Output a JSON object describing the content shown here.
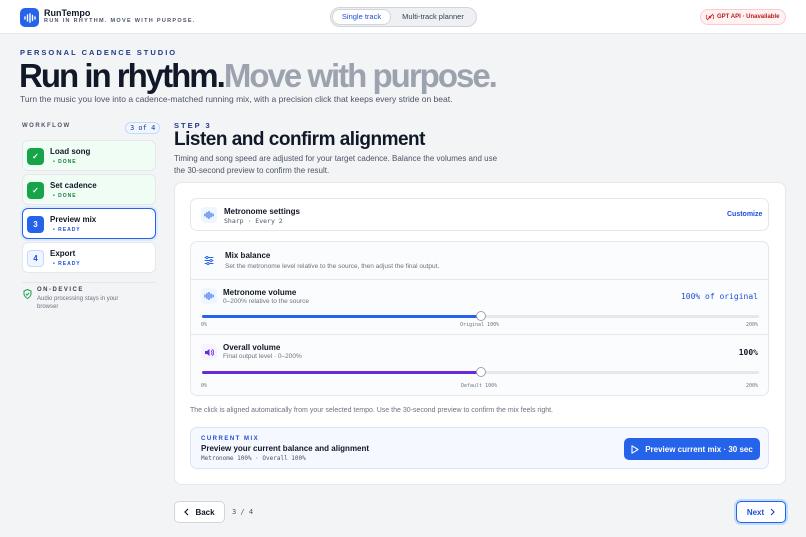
{
  "app": {
    "name": "RunTempo",
    "tagline": "RUN IN RHYTHM. MOVE WITH PURPOSE.",
    "logo_icon": "waveform-icon"
  },
  "header": {
    "modes": [
      {
        "label": "Single track",
        "active": true
      },
      {
        "label": "Multi-track planner",
        "active": false
      }
    ],
    "api_badge": "GPT API · Unavailable"
  },
  "hero": {
    "eyebrow": "PERSONAL CADENCE STUDIO",
    "title_dark": "Run in rhythm.",
    "title_light": "Move with purpose.",
    "subtitle": "Turn the music you love into a cadence-matched running mix, with a precision click that keeps every stride on beat."
  },
  "workflow": {
    "label": "WORKFLOW",
    "count": "3 of 4",
    "steps": [
      {
        "marker": "✓",
        "title": "Load song",
        "status": "DONE"
      },
      {
        "marker": "✓",
        "title": "Set cadence",
        "status": "DONE"
      },
      {
        "marker": "3",
        "title": "Preview mix",
        "status": "READY"
      },
      {
        "marker": "4",
        "title": "Export",
        "status": "READY"
      }
    ],
    "on_device_title": "ON-DEVICE",
    "on_device_text": "Audio processing stays in your browser"
  },
  "step": {
    "eyebrow": "STEP 3",
    "heading": "Listen and confirm alignment",
    "description": "Timing and song speed are adjusted for your target cadence. Balance the volumes and use the 30-second preview to confirm the result."
  },
  "metronome": {
    "title": "Metronome settings",
    "meta": "Sharp · Every 2",
    "customize": "Customize"
  },
  "mix_balance": {
    "title": "Mix balance",
    "subtitle": "Set the metronome level relative to the source, then adjust the final output.",
    "metronome_volume": {
      "label": "Metronome volume",
      "hint": "0–200% relative to the source",
      "value": "100% of original",
      "level": 0.5,
      "tick_min": "0%",
      "tick_mid": "Original 100%",
      "tick_max": "200%"
    },
    "overall_volume": {
      "label": "Overall volume",
      "hint": "Final output level · 0–200%",
      "value": "100%",
      "level": 0.5,
      "tick_min": "0%",
      "tick_mid": "Default 100%",
      "tick_max": "200%"
    }
  },
  "note": "The click is aligned automatically from your selected tempo. Use the 30-second preview to confirm the mix feels right.",
  "current_mix": {
    "eyebrow": "CURRENT MIX",
    "title": "Preview your current balance and alignment",
    "meta": "Metronome 100% · Overall 100%",
    "preview_button": "Preview current mix · 30 sec"
  },
  "footer": {
    "back": "Back",
    "pager": "3 / 4",
    "next": "Next"
  },
  "colors": {
    "accent": "#2563eb",
    "success": "#16a34a",
    "metronome_fill": "#2563eb",
    "overall_fill": "#6d28d9"
  }
}
